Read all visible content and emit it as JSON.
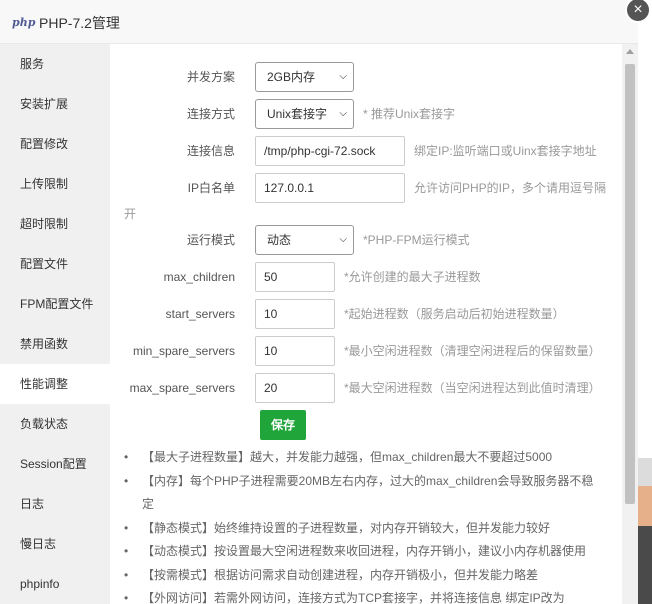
{
  "window": {
    "logo": "php",
    "title": "PHP-7.2管理",
    "close_symbol": "×"
  },
  "sidebar": {
    "items": [
      {
        "label": "服务"
      },
      {
        "label": "安装扩展"
      },
      {
        "label": "配置修改"
      },
      {
        "label": "上传限制"
      },
      {
        "label": "超时限制"
      },
      {
        "label": "配置文件"
      },
      {
        "label": "FPM配置文件"
      },
      {
        "label": "禁用函数"
      },
      {
        "label": "性能调整",
        "active": true
      },
      {
        "label": "负载状态"
      },
      {
        "label": "Session配置"
      },
      {
        "label": "日志"
      },
      {
        "label": "慢日志"
      },
      {
        "label": "phpinfo"
      }
    ]
  },
  "form": {
    "concurrency": {
      "label": "并发方案",
      "value": "2GB内存"
    },
    "conn_mode": {
      "label": "连接方式",
      "value": "Unix套接字",
      "hint": "* 推荐Unix套接字"
    },
    "conn_info": {
      "label": "连接信息",
      "value": "/tmp/php-cgi-72.sock",
      "hint": "绑定IP:监听端口或Uinx套接字地址"
    },
    "ip_whitelist": {
      "label": "IP白名单",
      "value": "127.0.0.1",
      "hint_part1": "允许访问PHP的IP，多个请用逗号隔",
      "hint_part2": "开"
    },
    "run_mode": {
      "label": "运行模式",
      "value": "动态",
      "hint": "*PHP-FPM运行模式"
    },
    "max_children": {
      "label": "max_children",
      "value": "50",
      "hint": "*允许创建的最大子进程数"
    },
    "start_servers": {
      "label": "start_servers",
      "value": "10",
      "hint": "*起始进程数（服务启动后初始进程数量）"
    },
    "min_spare_servers": {
      "label": "min_spare_servers",
      "value": "10",
      "hint": "*最小空闲进程数（清理空闲进程后的保留数量）"
    },
    "max_spare_servers": {
      "label": "max_spare_servers",
      "value": "20",
      "hint": "*最大空闲进程数（当空闲进程达到此值时清理）"
    },
    "save_label": "保存"
  },
  "tips": [
    "【最大子进程数量】越大，并发能力越强，但max_children最大不要超过5000",
    "【内存】每个PHP子进程需要20MB左右内存，过大的max_children会导致服务器不稳定",
    "【静态模式】始终维持设置的子进程数量，对内存开销较大，但并发能力较好",
    "【动态模式】按设置最大空闲进程数来收回进程，内存开销小，建议小内存机器使用",
    "【按需模式】根据访问需求自动创建进程，内存开销极小，但并发能力略差",
    "【外网访问】若需外网访问，连接方式为TCP套接字，并将连接信息 绑定IP改为"
  ]
}
